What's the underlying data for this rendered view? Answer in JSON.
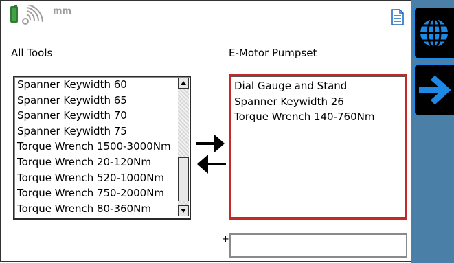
{
  "status": {
    "unit_label": "mm"
  },
  "left_panel": {
    "title": "All Tools",
    "items": [
      "Spanner Keywidth 60",
      "Spanner Keywidth 65",
      "Spanner Keywidth 70",
      "Spanner Keywidth 75",
      "Torque Wrench 1500-3000Nm",
      "Torque Wrench 20-120Nm",
      "Torque Wrench 520-1000Nm",
      "Torque Wrench 750-2000Nm",
      "Torque Wrench 80-360Nm"
    ]
  },
  "right_panel": {
    "title": "E-Motor Pumpset",
    "items": [
      "Dial Gauge and Stand",
      "Spanner Keywidth 26",
      "Torque Wrench 140-760Nm"
    ]
  },
  "add_field": {
    "prefix": "+",
    "value": "",
    "placeholder": ""
  },
  "icons": {
    "battery": "battery-icon",
    "signal": "wireless-signal-icon",
    "document": "document-icon",
    "transfer": "transfer-arrows-icon",
    "globe": "globe-icon",
    "next": "arrow-right-icon"
  },
  "colors": {
    "selected_border": "#c62828",
    "sidebar": "#4a7fa8",
    "side_button_border": "#1e88e5",
    "battery": "#43a047"
  }
}
